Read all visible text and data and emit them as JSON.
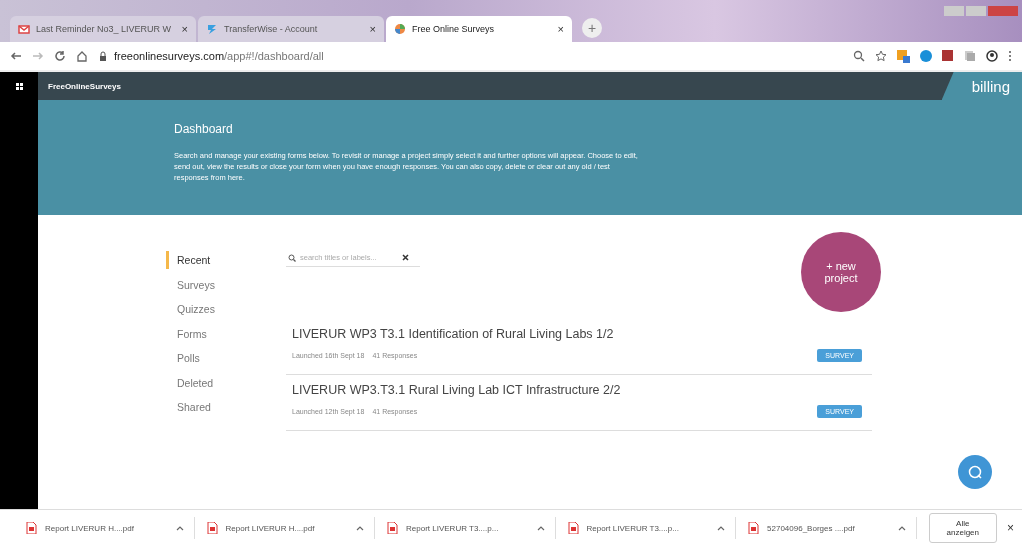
{
  "browser": {
    "tabs": [
      {
        "title": "Last Reminder No3_ LIVERUR W",
        "selected": false,
        "close": "×"
      },
      {
        "title": "TransferWise - Account",
        "selected": false,
        "close": "×"
      },
      {
        "title": "Free Online Surveys",
        "selected": true,
        "close": "×"
      }
    ],
    "new_tab": "+",
    "url_host": "freeonlinesurveys.com",
    "url_path": "/app#!/dashboard/all"
  },
  "app": {
    "logo": "FreeOnlineSurveys",
    "billing": "billing"
  },
  "banner": {
    "title": "Dashboard",
    "text": "Search and manage your existing forms below. To revisit or manage a project simply select it and further options will appear. Choose to edit, send out, view the results or close your form when you have enough responses. You can also copy, delete or clear out any old / test responses from here."
  },
  "sidebar": {
    "items": [
      {
        "label": "Recent",
        "selected": true
      },
      {
        "label": "Surveys",
        "selected": false
      },
      {
        "label": "Quizzes",
        "selected": false
      },
      {
        "label": "Forms",
        "selected": false
      },
      {
        "label": "Polls",
        "selected": false
      },
      {
        "label": "Deleted",
        "selected": false
      },
      {
        "label": "Shared",
        "selected": false
      }
    ]
  },
  "search": {
    "placeholder": "search titles or labels..."
  },
  "new_project": "+ new project",
  "projects": [
    {
      "title": "LIVERUR WP3 T3.1 Identification of Rural Living Labs 1/2",
      "launched": "Launched 16th Sept 18",
      "responses": "41 Responses",
      "type": "SURVEY"
    },
    {
      "title": "LIVERUR WP3.T3.1 Rural Living Lab ICT Infrastructure 2/2",
      "launched": "Launched 12th Sept 18",
      "responses": "41 Responses",
      "type": "SURVEY"
    }
  ],
  "downloads": {
    "files": [
      "Report LIVERUR H....pdf",
      "Report LIVERUR H....pdf",
      "Report LIVERUR T3....p...",
      "Report LIVERUR T3....p...",
      "52704096_Borges ....pdf"
    ],
    "show_all": "Alle anzeigen",
    "close": "×"
  }
}
